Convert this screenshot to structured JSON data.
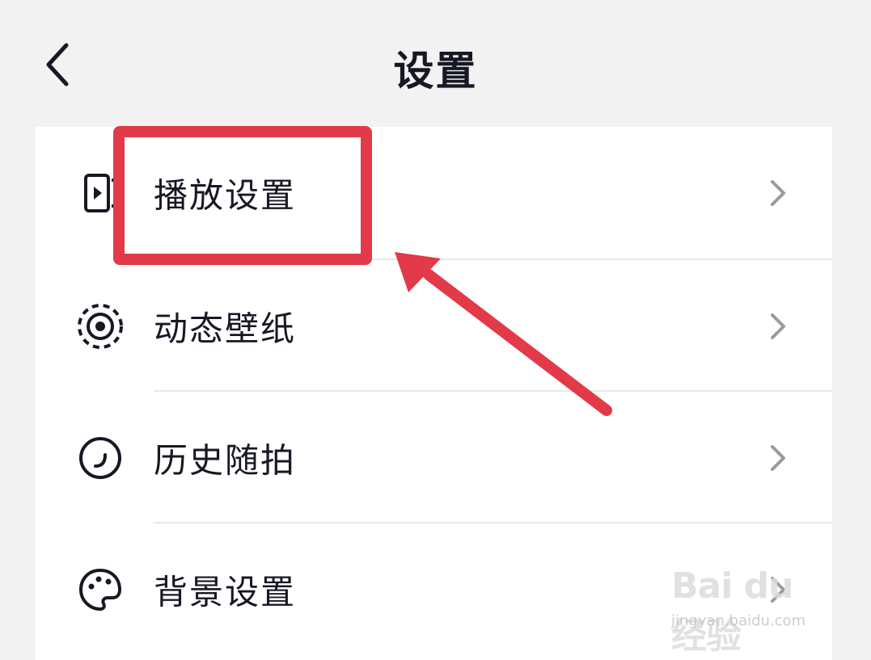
{
  "header": {
    "title": "设置",
    "back_icon": "chevron-left-icon"
  },
  "settings": {
    "items": [
      {
        "label": "播放设置",
        "icon": "play-screen-icon"
      },
      {
        "label": "动态壁纸",
        "icon": "wallpaper-icon"
      },
      {
        "label": "历史随拍",
        "icon": "history-icon"
      },
      {
        "label": "背景设置",
        "icon": "palette-icon"
      }
    ]
  },
  "annotation": {
    "highlight_color": "#e23a48"
  },
  "watermark": {
    "logo": "Bai du 经验",
    "url": "jingyan.baidu.com"
  }
}
